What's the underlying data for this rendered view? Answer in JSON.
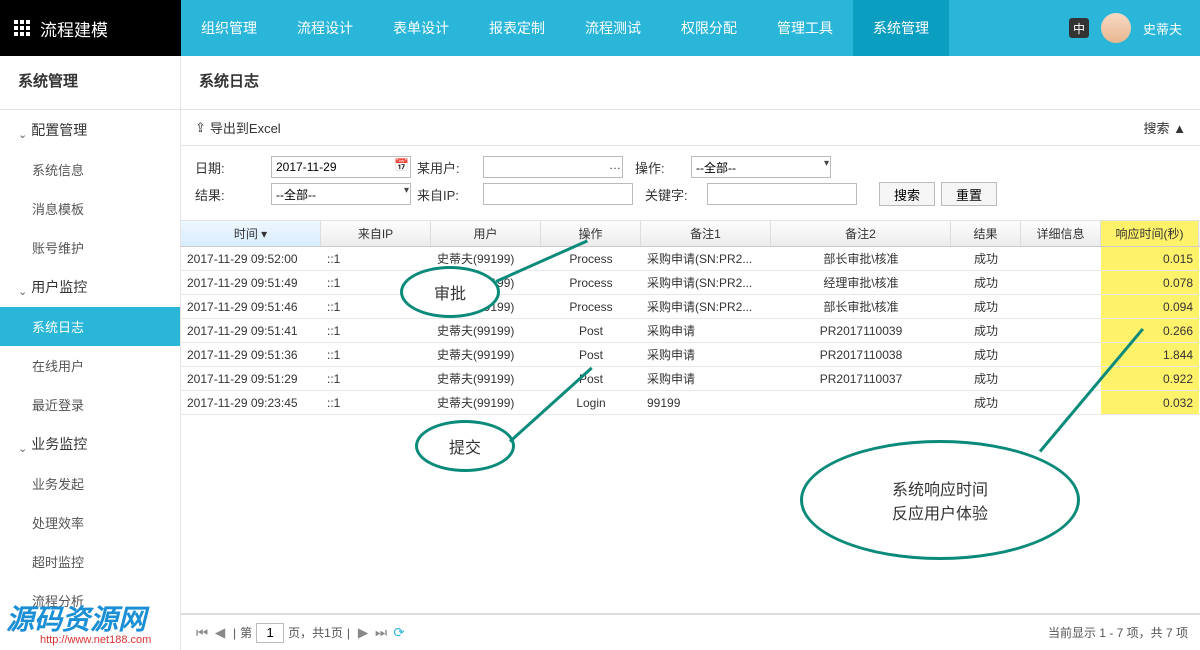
{
  "brand": "流程建模",
  "lang_badge": "中",
  "username": "史蒂夫",
  "nav": [
    "组织管理",
    "流程设计",
    "表单设计",
    "报表定制",
    "流程测试",
    "权限分配",
    "管理工具",
    "系统管理"
  ],
  "nav_active": 7,
  "sidebar": {
    "title": "系统管理",
    "groups": [
      {
        "label": "配置管理",
        "items": [
          "系统信息",
          "消息模板",
          "账号维护"
        ]
      },
      {
        "label": "用户监控",
        "items": [
          "系统日志",
          "在线用户",
          "最近登录"
        ],
        "active": 0
      },
      {
        "label": "业务监控",
        "items": [
          "业务发起",
          "处理效率",
          "超时监控",
          "流程分析"
        ]
      }
    ]
  },
  "page_title": "系统日志",
  "toolbar": {
    "export": "导出到Excel",
    "search_toggle": "搜索 ▲"
  },
  "filters": {
    "date_label": "日期:",
    "date_value": "2017-11-29",
    "user_label": "某用户:",
    "user_value": "",
    "action_label": "操作:",
    "action_value": "--全部--",
    "result_label": "结果:",
    "result_value": "--全部--",
    "ip_label": "来自IP:",
    "ip_value": "",
    "keyword_label": "关键字:",
    "keyword_value": "",
    "search_btn": "搜索",
    "reset_btn": "重置"
  },
  "columns": [
    "时间",
    "来自IP",
    "用户",
    "操作",
    "备注1",
    "备注2",
    "结果",
    "详细信息",
    "响应时间(秒)"
  ],
  "rows": [
    {
      "time": "2017-11-29 09:52:00",
      "ip": "::1",
      "user": "史蒂夫(99199)",
      "op": "Process",
      "r1": "采购申请(SN:PR2...",
      "r2": "部长审批\\核准",
      "res": "成功",
      "detail": "",
      "rt": "0.015"
    },
    {
      "time": "2017-11-29 09:51:49",
      "ip": "::1",
      "user": "史蒂夫(99199)",
      "op": "Process",
      "r1": "采购申请(SN:PR2...",
      "r2": "经理审批\\核准",
      "res": "成功",
      "detail": "",
      "rt": "0.078"
    },
    {
      "time": "2017-11-29 09:51:46",
      "ip": "::1",
      "user": "史蒂夫(99199)",
      "op": "Process",
      "r1": "采购申请(SN:PR2...",
      "r2": "部长审批\\核准",
      "res": "成功",
      "detail": "",
      "rt": "0.094"
    },
    {
      "time": "2017-11-29 09:51:41",
      "ip": "::1",
      "user": "史蒂夫(99199)",
      "op": "Post",
      "r1": "采购申请",
      "r2": "PR2017110039",
      "res": "成功",
      "detail": "",
      "rt": "0.266"
    },
    {
      "time": "2017-11-29 09:51:36",
      "ip": "::1",
      "user": "史蒂夫(99199)",
      "op": "Post",
      "r1": "采购申请",
      "r2": "PR2017110038",
      "res": "成功",
      "detail": "",
      "rt": "1.844"
    },
    {
      "time": "2017-11-29 09:51:29",
      "ip": "::1",
      "user": "史蒂夫(99199)",
      "op": "Post",
      "r1": "采购申请",
      "r2": "PR2017110037",
      "res": "成功",
      "detail": "",
      "rt": "0.922"
    },
    {
      "time": "2017-11-29 09:23:45",
      "ip": "::1",
      "user": "史蒂夫(99199)",
      "op": "Login",
      "r1": "99199",
      "r2": "",
      "res": "成功",
      "detail": "",
      "rt": "0.032"
    }
  ],
  "detail_header": "详细信息",
  "pager": {
    "page_prefix": "第",
    "page": "1",
    "page_suffix": "页，共1页",
    "summary": "当前显示 1 - 7 项，共 7 项"
  },
  "callouts": {
    "c1": "审批",
    "c2": "提交",
    "c3a": "系统响应时间",
    "c3b": "反应用户体验"
  },
  "watermark": "源码资源网",
  "watermark_url": "http://www.net188.com"
}
